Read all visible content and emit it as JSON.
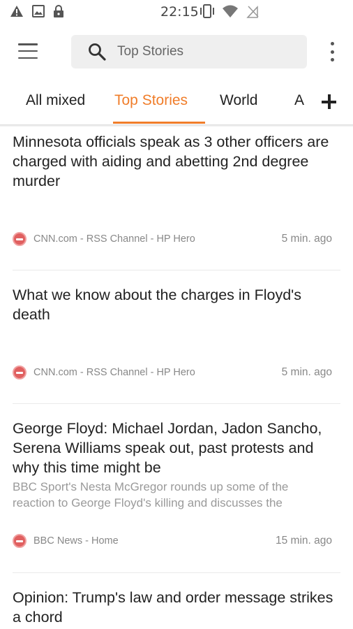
{
  "status_bar": {
    "time": "22:15",
    "left_icons": [
      "warning-icon",
      "image-icon",
      "lock-icon"
    ],
    "right_icons": [
      "vibrate-icon",
      "wifi-icon",
      "no-sim-icon"
    ]
  },
  "toolbar": {
    "search_placeholder": "Top Stories",
    "menu_icon": "hamburger-menu-icon",
    "search_icon": "search-icon",
    "overflow_icon": "more-vert-icon"
  },
  "tabs": {
    "items": [
      {
        "label": "All mixed",
        "active": false
      },
      {
        "label": "Top Stories",
        "active": true
      },
      {
        "label": "World",
        "active": false
      },
      {
        "label": "A",
        "active": false
      }
    ],
    "accent_color": "#f07d2a"
  },
  "feed": {
    "articles": [
      {
        "title": "Minnesota officials speak as 3 other officers are charged with aiding and abetting 2nd degree murder",
        "summary": "",
        "source": "CNN.com - RSS Channel - HP Hero",
        "time": "5 min. ago"
      },
      {
        "title": "What we know about the charges in Floyd's death",
        "summary": "",
        "source": "CNN.com - RSS Channel - HP Hero",
        "time": "5 min. ago"
      },
      {
        "title": "George Floyd: Michael Jordan, Jadon Sancho, Serena Williams speak out, past protests and why this time might be",
        "summary_line1": "BBC Sport's Nesta McGregor rounds up some of the",
        "summary_line2": "reaction to George Floyd's killing and discusses the",
        "source": "BBC News - Home",
        "time": "15 min. ago"
      },
      {
        "title": "Opinion: Trump's law and order message strikes a chord",
        "summary": "",
        "source": "",
        "time": ""
      }
    ]
  }
}
